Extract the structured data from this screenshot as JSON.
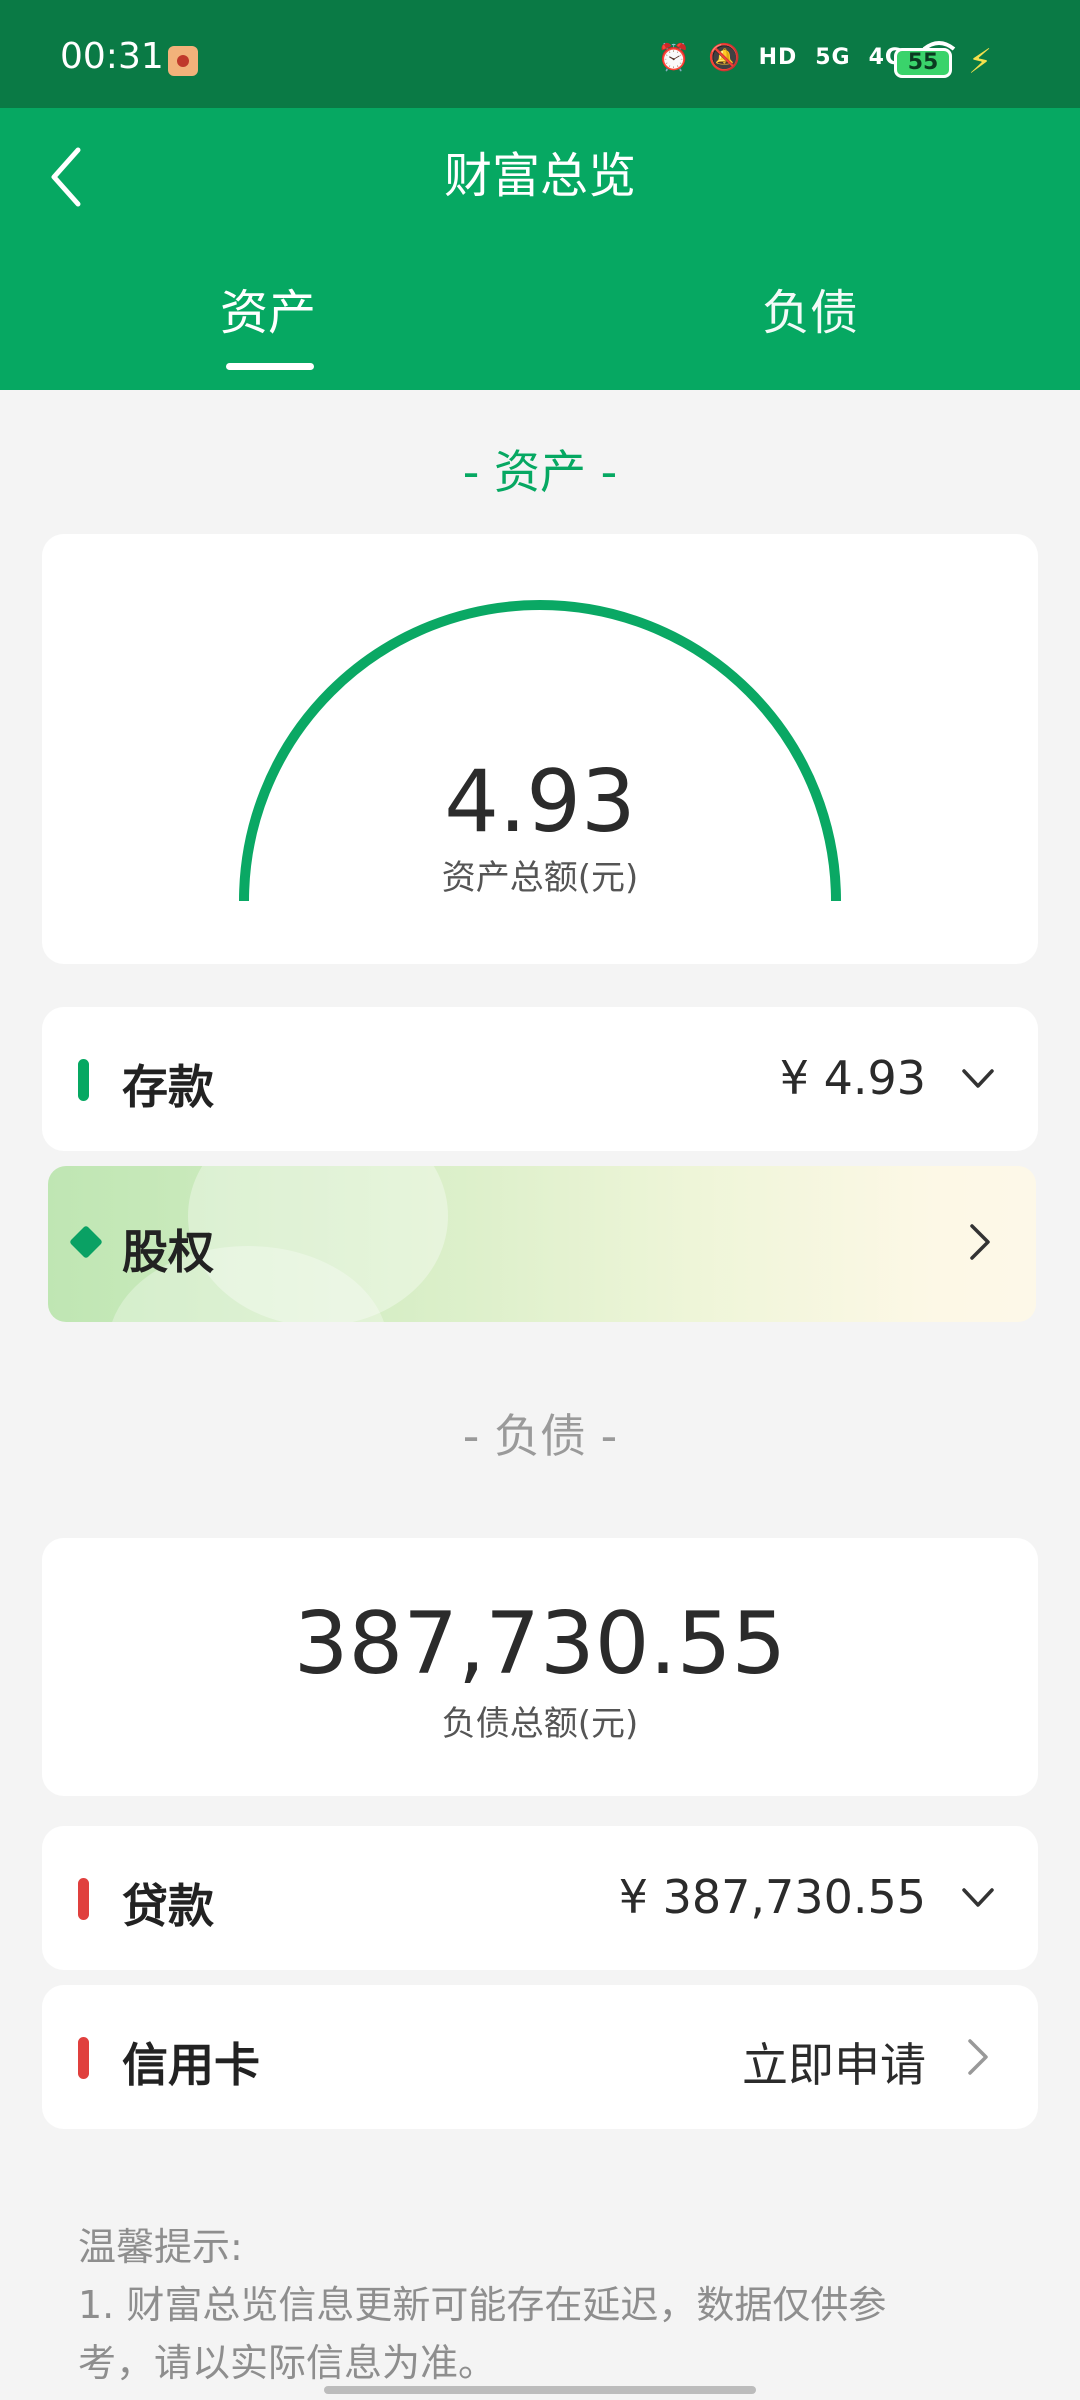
{
  "status_bar": {
    "time": "00:31",
    "network_hd": "HD",
    "signal1": "5G",
    "signal2": "4G",
    "battery": "55"
  },
  "header": {
    "title": "财富总览",
    "tabs": [
      {
        "label": "资产",
        "active": true
      },
      {
        "label": "负债",
        "active": false
      }
    ]
  },
  "assets": {
    "section_title": "- 资产 -",
    "total_value": "4.93",
    "total_label": "资产总额(元)",
    "rows": [
      {
        "label": "存款",
        "value": "¥ 4.93"
      },
      {
        "label": "股权"
      }
    ]
  },
  "liabilities": {
    "section_title": "- 负债 -",
    "total_value": "387,730.55",
    "total_label": "负债总额(元)",
    "rows": [
      {
        "label": "贷款",
        "value": "¥ 387,730.55"
      },
      {
        "label": "信用卡",
        "value": "立即申请"
      }
    ]
  },
  "tips": {
    "title": "温馨提示:",
    "lines": [
      "1. 财富总览信息更新可能存在延迟，数据仅供参考，请以实际信息为准。"
    ]
  },
  "colors": {
    "status_bg": "#0a7a45",
    "header_bg": "#06a862",
    "asset_accent": "#06a862",
    "debt_accent": "#e0403e"
  }
}
